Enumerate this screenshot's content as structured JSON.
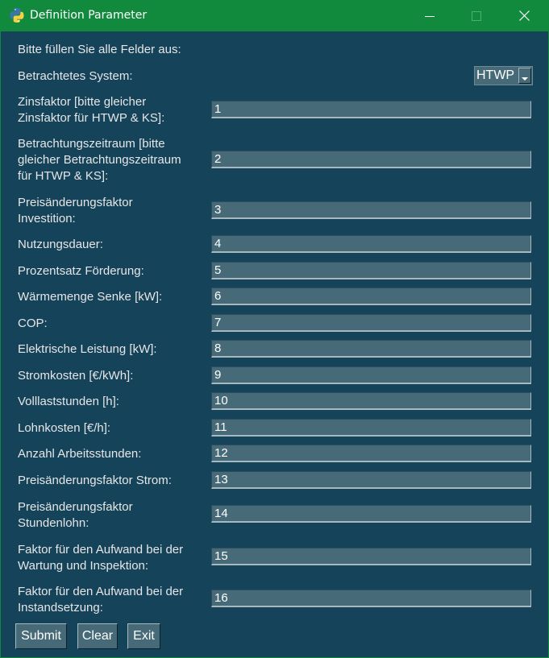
{
  "window": {
    "title": "Definition Parameter",
    "icon": "python-icon",
    "controls": [
      "minimize-icon",
      "maximize-icon",
      "close-icon"
    ],
    "titlebar_color": "#128a3e",
    "background_color": "#15435a"
  },
  "form": {
    "instruction": "Bitte füllen Sie alle Felder aus:",
    "system_label": "Betrachtetes System:",
    "system_value": "HTWP",
    "fields": [
      {
        "label": "Zinsfaktor [bitte gleicher\nZinsfaktor für HTWP & KS]:",
        "value": "1"
      },
      {
        "label": "Betrachtungszeitraum [bitte\ngleicher Betrachtungszeitraum\nfür HTWP & KS]:",
        "value": "2"
      },
      {
        "label": "Preisänderungsfaktor\nInvestition:",
        "value": "3"
      },
      {
        "label": "Nutzungsdauer:",
        "value": "4"
      },
      {
        "label": "Prozentsatz Förderung:",
        "value": "5"
      },
      {
        "label": "Wärmemenge Senke [kW]:",
        "value": "6"
      },
      {
        "label": "COP:",
        "value": "7"
      },
      {
        "label": "Elektrische Leistung [kW]:",
        "value": "8"
      },
      {
        "label": "Stromkosten [€/kWh]:",
        "value": "9"
      },
      {
        "label": "Volllaststunden [h]:",
        "value": "10"
      },
      {
        "label": "Lohnkosten [€/h]:",
        "value": "11"
      },
      {
        "label": "Anzahl Arbeitsstunden:",
        "value": "12"
      },
      {
        "label": "Preisänderungsfaktor Strom:",
        "value": "13"
      },
      {
        "label": "Preisänderungsfaktor\nStundenlohn:",
        "value": "14"
      },
      {
        "label": "Faktor für den Aufwand bei der\nWartung und Inspektion:",
        "value": "15"
      },
      {
        "label": "Faktor für den Aufwand bei der\nInstandsetzung:",
        "value": "16"
      }
    ]
  },
  "buttons": {
    "submit": "Submit",
    "clear": "Clear",
    "exit": "Exit"
  }
}
